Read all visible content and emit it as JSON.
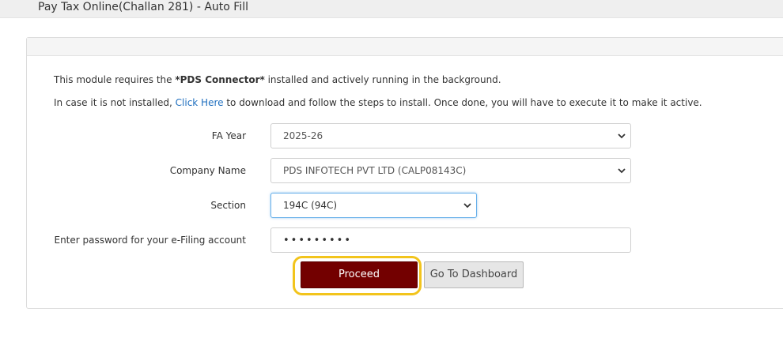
{
  "header": {
    "title": "Pay Tax Online(Challan 281) - Auto Fill"
  },
  "info": {
    "line1_prefix": "This module requires the ",
    "line1_bold": "*PDS Connector*",
    "line1_suffix": " installed and actively running in the background.",
    "line2_prefix": "In case it is not installed, ",
    "line2_link": "Click Here",
    "line2_suffix": " to download and follow the steps to install. Once done, you will have to execute it to make it active."
  },
  "form": {
    "fa_year": {
      "label": "FA Year",
      "value": "2025-26"
    },
    "company": {
      "label": "Company Name",
      "value": "PDS INFOTECH PVT LTD (CALP08143C)"
    },
    "section": {
      "label": "Section",
      "value": "194C (94C)"
    },
    "password": {
      "label": "Enter password for your e-Filing account",
      "value": "•••••••••"
    }
  },
  "buttons": {
    "proceed": "Proceed",
    "dashboard": "Go To Dashboard"
  },
  "colors": {
    "proceed_bg": "#730000",
    "highlight": "#f2c41c",
    "link": "#1f6fbf"
  }
}
